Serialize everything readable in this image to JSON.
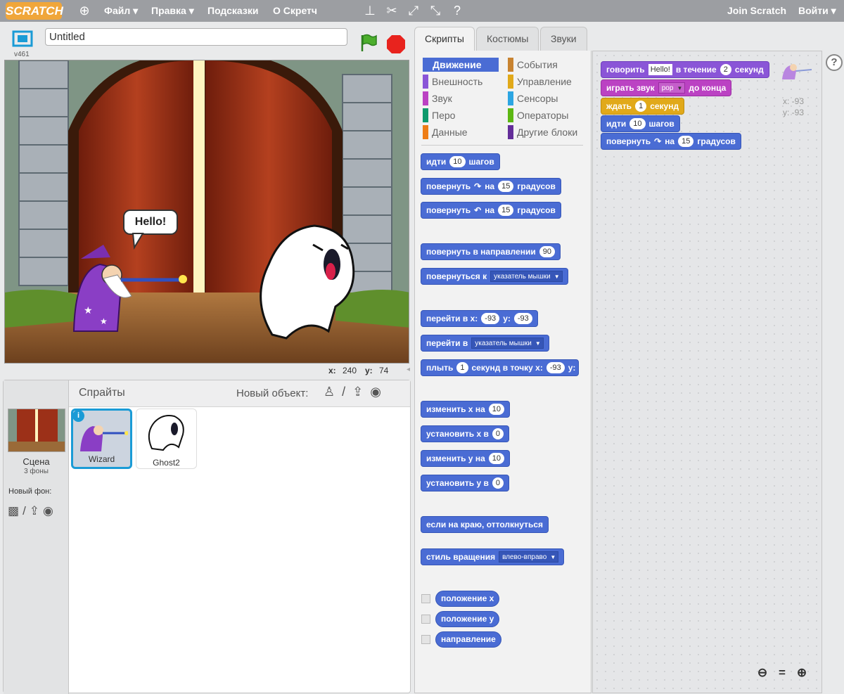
{
  "topbar": {
    "logo": "SCRATCH",
    "menu": [
      "Файл ▾",
      "Правка ▾",
      "Подсказки",
      "О Скретч"
    ],
    "join": "Join Scratch",
    "signin": "Войти ▾"
  },
  "stage": {
    "version": "v461",
    "title": "Untitled",
    "speech": "Hello!",
    "x_label": "x:",
    "x_val": "240",
    "y_label": "y:",
    "y_val": "74"
  },
  "sprites": {
    "header": "Спрайты",
    "new_object": "Новый объект:",
    "list": [
      "Wizard",
      "Ghost2"
    ],
    "stage_label": "Сцена",
    "stage_sub": "3 фоны",
    "new_backdrop": "Новый фон:"
  },
  "tabs": [
    "Скрипты",
    "Костюмы",
    "Звуки"
  ],
  "categories": [
    {
      "name": "Движение",
      "color": "#4a6cd4"
    },
    {
      "name": "События",
      "color": "#c88330"
    },
    {
      "name": "Внешность",
      "color": "#8a55d7"
    },
    {
      "name": "Управление",
      "color": "#e1a91a"
    },
    {
      "name": "Звук",
      "color": "#bb42c3"
    },
    {
      "name": "Сенсоры",
      "color": "#2ca5e2"
    },
    {
      "name": "Перо",
      "color": "#0e9a6c"
    },
    {
      "name": "Операторы",
      "color": "#5cb712"
    },
    {
      "name": "Данные",
      "color": "#ee7d16"
    },
    {
      "name": "Другие блоки",
      "color": "#632d99"
    }
  ],
  "palette": {
    "move": "идти",
    "steps": "шагов",
    "move_n": "10",
    "turn": "повернуть",
    "on": "на",
    "degrees": "градусов",
    "turn_n": "15",
    "point_dir": "повернуть в направлении",
    "dir_n": "90",
    "point_towards": "повернуться к",
    "mouse": "указатель мышки",
    "goto_xy": "перейти в x:",
    "y": "y:",
    "gx": "-93",
    "gy": "-93",
    "goto": "перейти в",
    "glide": "плыть",
    "glide_n": "1",
    "glide_mid": "секунд в точку x:",
    "glx": "-93",
    "change_x": "изменить x на",
    "cx": "10",
    "set_x": "установить x в",
    "sx": "0",
    "change_y": "изменить y на",
    "cy": "10",
    "set_y": "установить y в",
    "sy": "0",
    "bounce": "если на краю, оттолкнуться",
    "rot_style": "стиль вращения",
    "rot_val": "влево-вправо",
    "rep_x": "положение x",
    "rep_y": "положение y",
    "rep_dir": "направление"
  },
  "script": {
    "say": "говорить",
    "say_val": "Hello!",
    "say_mid": "в течение",
    "say_n": "2",
    "say_end": "секунд",
    "play": "играть звук",
    "play_val": "pop",
    "play_end": "до конца",
    "wait": "ждать",
    "wait_n": "1",
    "wait_end": "секунд",
    "move": "идти",
    "move_n": "10",
    "move_end": "шагов",
    "turn": "повернуть",
    "turn_mid": "на",
    "turn_n": "15",
    "turn_end": "градусов",
    "sprite_x": "x: -93",
    "sprite_y": "y: -93"
  }
}
